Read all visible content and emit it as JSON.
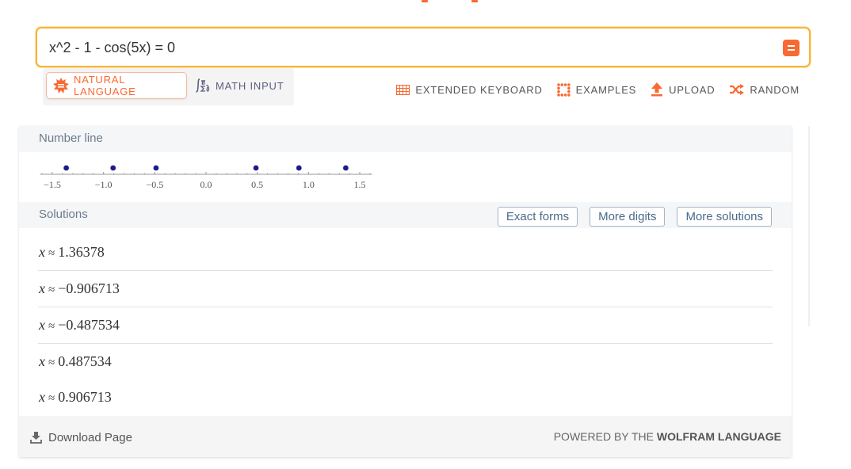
{
  "search": {
    "value": "x^2 - 1 - cos(5x) = 0",
    "compute_icon": "equals-icon"
  },
  "input_modes": {
    "natural": {
      "label": "NATURAL LANGUAGE",
      "icon": "natural-language-icon",
      "active": true
    },
    "math": {
      "label": "MATH INPUT",
      "icon": "math-input-icon",
      "active": false
    }
  },
  "tools": [
    {
      "label": "EXTENDED KEYBOARD",
      "icon": "keyboard-icon"
    },
    {
      "label": "EXAMPLES",
      "icon": "examples-grid-icon"
    },
    {
      "label": "UPLOAD",
      "icon": "upload-icon"
    },
    {
      "label": "RANDOM",
      "icon": "shuffle-icon"
    }
  ],
  "pods": {
    "number_line": {
      "title": "Number line",
      "ticks": [
        "-1.5",
        "-1.0",
        "-0.5",
        "0.0",
        "0.5",
        "1.0",
        "1.5"
      ],
      "points": [
        -1.36378,
        -0.906713,
        -0.487534,
        0.487534,
        0.906713,
        1.36378
      ]
    },
    "solutions": {
      "title": "Solutions",
      "buttons": {
        "exact_forms": "Exact forms",
        "more_digits": "More digits",
        "more_solutions": "More solutions"
      },
      "variable": "x",
      "approx_symbol": "≈",
      "items": [
        "1.36378",
        "−0.906713",
        "−0.487534",
        "0.487534",
        "0.906713"
      ]
    }
  },
  "footer": {
    "download_label": "Download Page",
    "powered_prefix": "POWERED BY THE ",
    "powered_brand": "WOLFRAM LANGUAGE"
  },
  "colors": {
    "accent_orange": "#f96932",
    "search_border": "#f9b436",
    "point_color": "#1f1a8c"
  }
}
